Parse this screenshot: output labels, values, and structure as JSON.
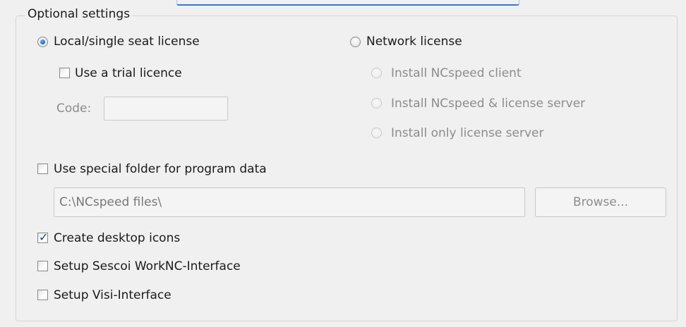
{
  "group": {
    "title": "Optional settings"
  },
  "license": {
    "local_label": "Local/single seat license",
    "local_selected": true,
    "network_label": "Network license",
    "network_selected": false,
    "trial_label": "Use a trial licence",
    "trial_checked": false,
    "code_label": "Code:",
    "code_value": "",
    "network_options": [
      {
        "label": "Install NCspeed client"
      },
      {
        "label": "Install NCspeed & license server"
      },
      {
        "label": "Install only license server"
      }
    ]
  },
  "folder": {
    "checkbox_label": "Use special folder for program data",
    "checked": false,
    "path_value": "C:\\NCspeed files\\",
    "browse_label": "Browse..."
  },
  "options": [
    {
      "label": "Create desktop icons",
      "checked": true
    },
    {
      "label": "Setup Sescoi WorkNC-Interface",
      "checked": false
    },
    {
      "label": "Setup Visi-Interface",
      "checked": false
    }
  ]
}
